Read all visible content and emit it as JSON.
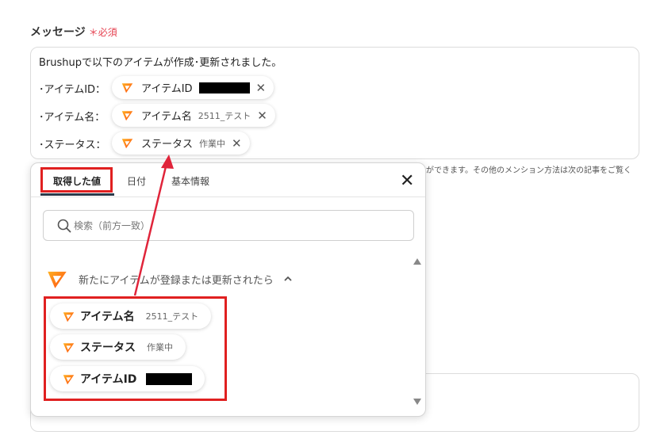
{
  "field": {
    "label": "メッセージ",
    "required": "＊必須"
  },
  "message": {
    "line1": "Brushupで以下のアイテムが作成･更新されました。",
    "rows": [
      {
        "label": "･アイテムID：",
        "pill_name": "アイテムID",
        "pill_value": ""
      },
      {
        "label": "･アイテム名：",
        "pill_name": "アイテム名",
        "pill_value": "2511_テスト"
      },
      {
        "label": "･ステータス：",
        "pill_name": "ステータス",
        "pill_value": "作業中"
      }
    ]
  },
  "hint": "ができます。その他のメンション方法は次の記事をご覧く",
  "popover": {
    "tabs": [
      {
        "label": "取得した値",
        "active": true
      },
      {
        "label": "日付",
        "active": false
      },
      {
        "label": "基本情報",
        "active": false
      }
    ],
    "search_placeholder": "検索（前方一致）",
    "section_title": "新たにアイテムが登録または更新されたら",
    "options": [
      {
        "name": "アイテム名",
        "value": "2511_テスト"
      },
      {
        "name": "ステータス",
        "value": "作業中"
      },
      {
        "name": "アイテムID",
        "value": ""
      }
    ]
  },
  "colors": {
    "highlight": "#e02020",
    "required": "#e5404f",
    "brand_orange": "#ff6a1a",
    "arrow": "#e0243a"
  },
  "icons": {
    "brand": "brushup-logo-icon",
    "close": "close-icon",
    "remove": "remove-x-icon",
    "search": "search-icon",
    "collapse": "chevron-up-icon",
    "scroll_up": "scroll-up-arrow-icon",
    "scroll_down": "scroll-down-arrow-icon"
  }
}
